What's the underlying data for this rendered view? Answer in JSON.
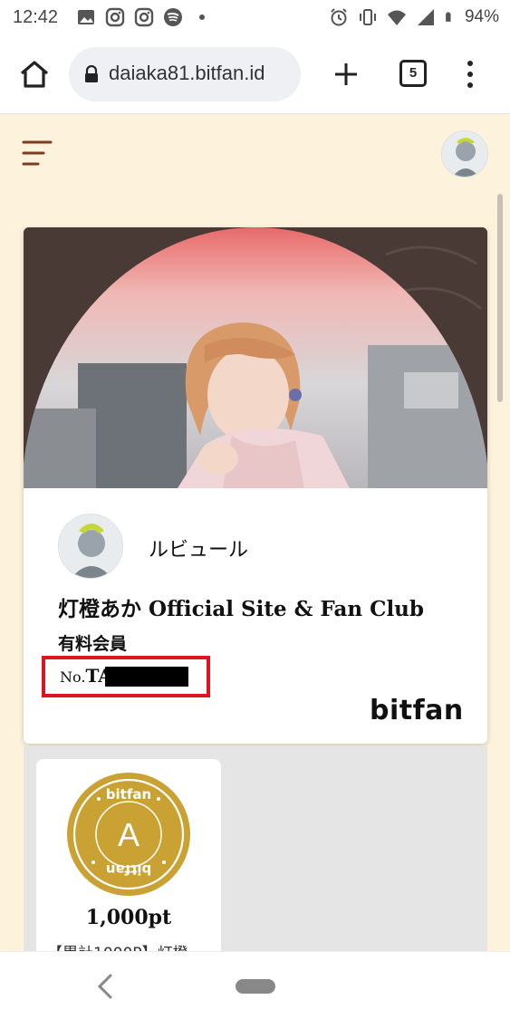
{
  "status_bar": {
    "time": "12:42",
    "battery": "94%",
    "left_icons": [
      "gallery-icon",
      "instagram-icon",
      "instagram-icon",
      "spotify-icon",
      "dot-icon"
    ],
    "right_icons": [
      "alarm-icon",
      "vibrate-icon",
      "wifi-icon",
      "signal-icon",
      "battery-icon"
    ]
  },
  "browser": {
    "url": "daiaka81.bitfan.id",
    "tab_count": "5"
  },
  "card": {
    "member_name": "ルビュール",
    "club_name": "灯橙あか Official Site & Fan Club",
    "member_type": "有料会員",
    "number_prefix": "No.",
    "number_value": "TA-",
    "brand": "bitfan"
  },
  "coin": {
    "top_text": "bitfan",
    "letter": "A",
    "bottom_text": "bitfan",
    "points": "1,000pt",
    "description": "【累計1000P】灯橙"
  },
  "colors": {
    "page_bg": "#fdf2dc",
    "accent_brown": "#6b3a22",
    "coin_gold": "#c9a233",
    "highlight_red": "#e0141e"
  }
}
